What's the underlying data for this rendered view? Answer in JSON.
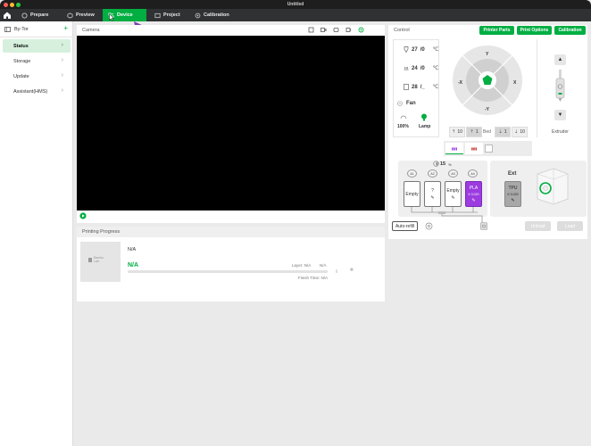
{
  "window": {
    "title": "Untitled"
  },
  "colors": {
    "accent": "#00ae42",
    "pla": "#9b3be0",
    "tpu": "#a8a8a8"
  },
  "tabs": [
    {
      "label": "Prepare",
      "icon": "prepare-icon"
    },
    {
      "label": "Preview",
      "icon": "preview-icon"
    },
    {
      "label": "Device",
      "icon": "device-icon",
      "active": true
    },
    {
      "label": "Project",
      "icon": "project-icon"
    },
    {
      "label": "Calibration",
      "icon": "calibration-icon"
    }
  ],
  "sidebar": {
    "printer": "By-Tor",
    "items": [
      {
        "label": "Status",
        "selected": true
      },
      {
        "label": "Storage"
      },
      {
        "label": "Update"
      },
      {
        "label": "Assistant(HMS)"
      }
    ]
  },
  "camera": {
    "title": "Camera"
  },
  "progress": {
    "title": "Printing Progress",
    "name": "N/A",
    "percent": "N/A",
    "layer_label": "Layer: N/A",
    "layer_value": "N/A",
    "finish_time": "Finish Time: N/A",
    "logo_line1": "Bambu",
    "logo_line2": "Lab"
  },
  "control": {
    "title": "Control",
    "buttons": {
      "printer_parts": "Printer Parts",
      "print_options": "Print Options",
      "calibration": "Calibration"
    },
    "temps": [
      {
        "value": "27",
        "target": "/0",
        "unit": "℃",
        "icon": "nozzle-icon"
      },
      {
        "value": "24",
        "target": "/0",
        "unit": "℃",
        "icon": "bed-icon"
      },
      {
        "value": "28",
        "target": "/_",
        "unit": "℃",
        "icon": "chamber-icon"
      }
    ],
    "fan_label": "Fan",
    "fan_value": "100%",
    "lamp_label": "Lamp",
    "jog": {
      "up": "Y",
      "down": "-Y",
      "left": "-X",
      "right": "X"
    },
    "bed_label": "Bed",
    "bed_steps": [
      "10",
      "1",
      "1",
      "10"
    ],
    "extruder_label": "Extruder"
  },
  "ams": {
    "humidity": "15",
    "humidity_unit": "%",
    "slots": [
      {
        "label": "A1",
        "text": "Empty"
      },
      {
        "label": "A2",
        "text": "?"
      },
      {
        "label": "A3",
        "text": "Empty"
      },
      {
        "label": "A4",
        "text": "PLA",
        "sub": "K 0.020"
      }
    ],
    "ext": {
      "label": "Ext",
      "text": "TPU",
      "sub": "K 0.020"
    },
    "auto_refill": "Auto-refill",
    "unload": "Unload",
    "load": "Load"
  }
}
